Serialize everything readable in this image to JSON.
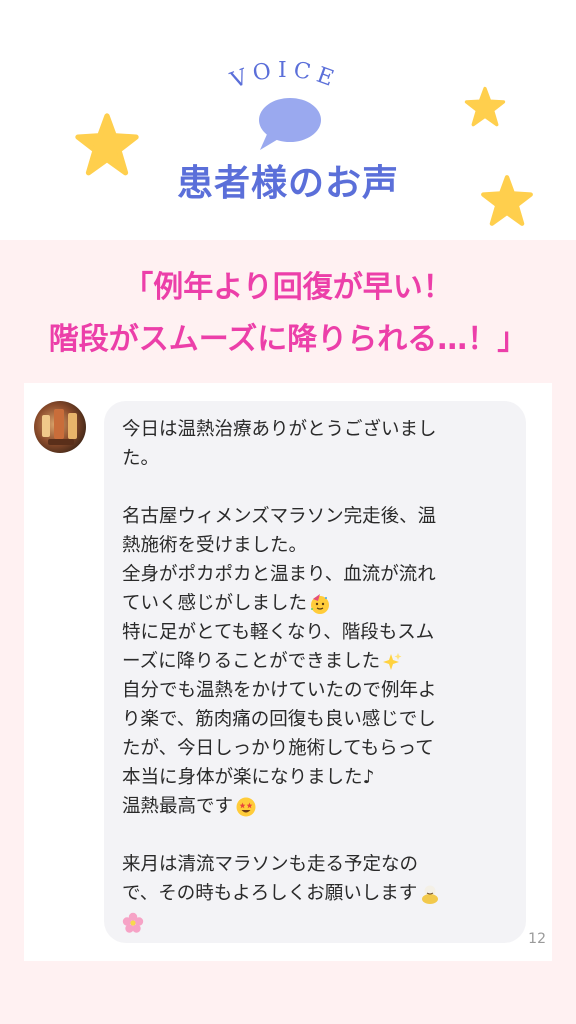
{
  "header": {
    "voice_label": "VOICE",
    "title": "患者様のお声"
  },
  "headline": {
    "line1": "「例年より回復が早い！",
    "line2": "階段がスムーズに降りられる…！」"
  },
  "message": {
    "lines": [
      "今日は温熱治療ありがとうございまし",
      "た。",
      "",
      "名古屋ウィメンズマラソン完走後、温",
      "熱施術を受けました。",
      "全身がポカポカと温まり、血流が流れ",
      "ていく感じがしました",
      "特に足がとても軽くなり、階段もスム",
      "ーズに降りることができました",
      "自分でも温熱をかけていたので例年よ",
      "り楽で、筋肉痛の回復も良い感じでし",
      "たが、今日しっかり施術してもらって",
      "本当に身体が楽になりました♪",
      "温熱最高です",
      "",
      "来月は清流マラソンも走る予定なの",
      "で、その時もよろしくお願いします",
      ""
    ],
    "page_number": "12"
  },
  "colors": {
    "title": "#5b6fd9",
    "headline": "#ec3fa9",
    "star": "#ffcf4d",
    "bubble": "#9aa9ef",
    "background": "#fff1f2"
  },
  "icons": {
    "emoji_line7": "partying-face-icon",
    "emoji_line9": "sparkles-icon",
    "emoji_line14": "star-struck-face-icon",
    "emoji_line17": "bowing-person-icon",
    "emoji_line18": "cherry-blossom-icon"
  }
}
